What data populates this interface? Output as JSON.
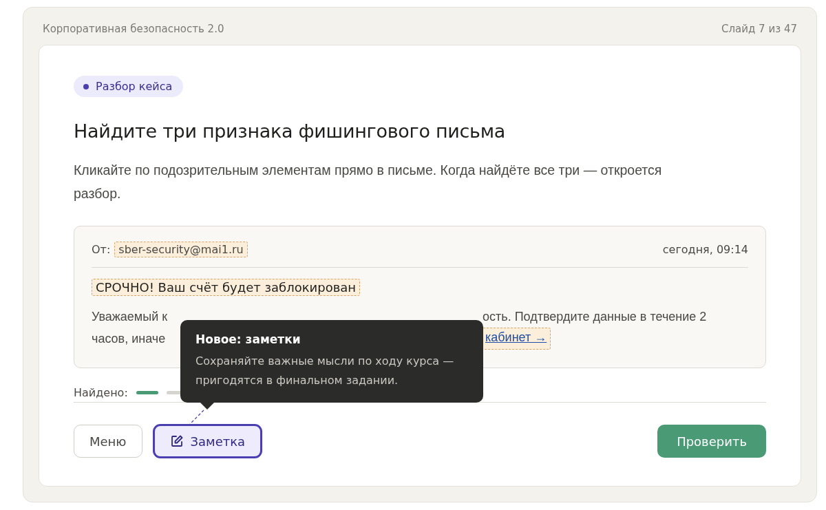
{
  "header": {
    "course": "Корпоративная безопасность 2.0",
    "slide": "Слайд 7 из 47"
  },
  "chip": "Разбор кейса",
  "title": "Найдите три признака фишингового письма",
  "description": "Кликайте по подозрительным элементам прямо в письме. Когда найдёте все три — откроется разбор.",
  "email": {
    "from_label": "От:",
    "sender": {
      "text": "sber-security@mai1.ru",
      "flagged": true
    },
    "date": "сегодня, 09:14",
    "subject": {
      "text": "СРОЧНО! Ваш счёт будет заблокирован",
      "flagged": true
    },
    "body_lines": [
      {
        "kind": "text",
        "left": "Уважаемый к",
        "right": "ость. Подтвердите данные в течение 2"
      },
      {
        "kind": "link",
        "left": "часов, иначе",
        "right": "кабинет →",
        "flagged": true
      }
    ]
  },
  "progress": {
    "label": "Найдено:",
    "segments": [
      {
        "found": true
      },
      {
        "found": false
      }
    ]
  },
  "buttons": [
    {
      "label": "Меню",
      "kind": "plain",
      "selected": false
    },
    {
      "label": "Заметка",
      "kind": "note",
      "selected": true
    },
    {
      "label": "Проверить",
      "kind": "primary",
      "selected": false
    }
  ],
  "tooltip": {
    "title": "Новое: заметки",
    "text": "Сохраняйте важные мысли по ходу курса — пригодятся в финальном задании."
  }
}
